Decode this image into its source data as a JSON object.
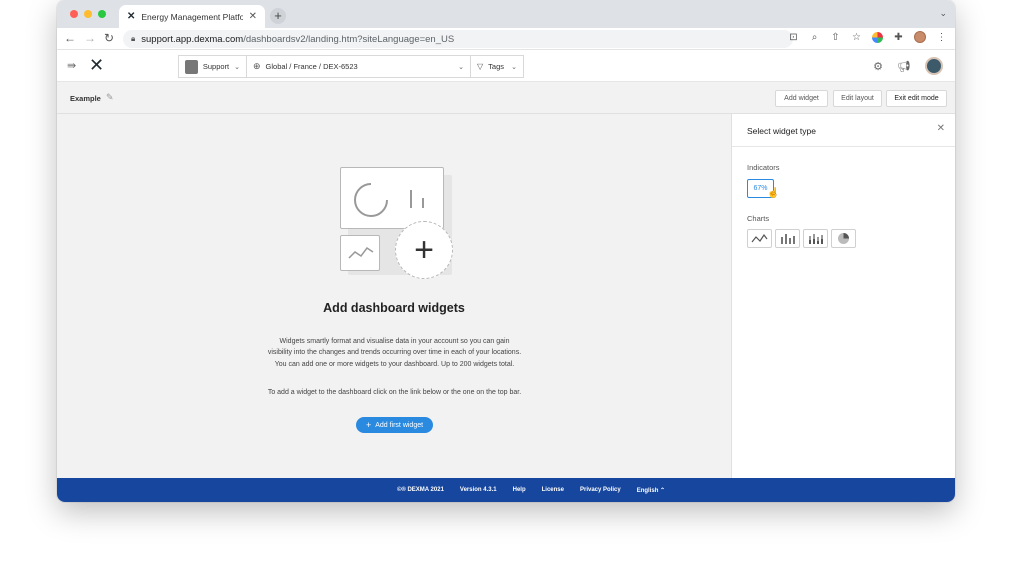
{
  "browser": {
    "tab_title": "Energy Management Platform -",
    "url_host": "support.app.dexma.com",
    "url_path": "/dashboardsv2/landing.htm?siteLanguage=en_US"
  },
  "header": {
    "support_label": "Support",
    "location_label": "Global / France / DEX-6523",
    "tags_label": "Tags"
  },
  "subheader": {
    "dashboard_name": "Example",
    "add_widget": "Add widget",
    "edit_layout": "Edit layout",
    "exit_edit": "Exit edit mode"
  },
  "empty_state": {
    "title": "Add dashboard widgets",
    "description": "Widgets smartly format and visualise data in your account so you can gain visibility into the changes and trends occurring over time in each of your locations. You can add one or more widgets to your dashboard. Up to 200 widgets total.",
    "hint": "To add a widget to the dashboard click on the link below or the one on the top bar.",
    "button": "Add first widget"
  },
  "panel": {
    "title": "Select widget type",
    "indicators_label": "Indicators",
    "indicator_tile": "67%",
    "charts_label": "Charts",
    "chart_tiles": [
      "line-chart-icon",
      "bar-chart-icon",
      "stacked-bar-chart-icon",
      "pie-chart-icon"
    ]
  },
  "footer": {
    "copyright": "©® DEXMA 2021",
    "version": "Version 4.3.1",
    "help": "Help",
    "license": "License",
    "privacy": "Privacy Policy",
    "language": "English"
  },
  "colors": {
    "accent": "#2a8ae0",
    "footer": "#17469e"
  }
}
